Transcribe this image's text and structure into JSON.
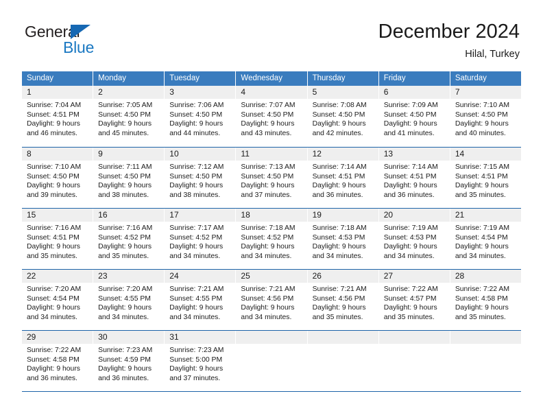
{
  "logo": {
    "word1": "General",
    "word2": "Blue",
    "triangle_color": "#1668b3",
    "word2_color": "#1a78c2"
  },
  "header": {
    "title": "December 2024",
    "subtitle": "Hilal, Turkey"
  },
  "theme": {
    "header_bg": "#3a7cbe",
    "row_divider": "#1c63a8",
    "daynum_band": "#efefef",
    "text": "#1a1a1a"
  },
  "calendar": {
    "day_names": [
      "Sunday",
      "Monday",
      "Tuesday",
      "Wednesday",
      "Thursday",
      "Friday",
      "Saturday"
    ],
    "weeks": [
      [
        {
          "day": "1",
          "lines": [
            "Sunrise: 7:04 AM",
            "Sunset: 4:51 PM",
            "Daylight: 9 hours",
            "and 46 minutes."
          ]
        },
        {
          "day": "2",
          "lines": [
            "Sunrise: 7:05 AM",
            "Sunset: 4:50 PM",
            "Daylight: 9 hours",
            "and 45 minutes."
          ]
        },
        {
          "day": "3",
          "lines": [
            "Sunrise: 7:06 AM",
            "Sunset: 4:50 PM",
            "Daylight: 9 hours",
            "and 44 minutes."
          ]
        },
        {
          "day": "4",
          "lines": [
            "Sunrise: 7:07 AM",
            "Sunset: 4:50 PM",
            "Daylight: 9 hours",
            "and 43 minutes."
          ]
        },
        {
          "day": "5",
          "lines": [
            "Sunrise: 7:08 AM",
            "Sunset: 4:50 PM",
            "Daylight: 9 hours",
            "and 42 minutes."
          ]
        },
        {
          "day": "6",
          "lines": [
            "Sunrise: 7:09 AM",
            "Sunset: 4:50 PM",
            "Daylight: 9 hours",
            "and 41 minutes."
          ]
        },
        {
          "day": "7",
          "lines": [
            "Sunrise: 7:10 AM",
            "Sunset: 4:50 PM",
            "Daylight: 9 hours",
            "and 40 minutes."
          ]
        }
      ],
      [
        {
          "day": "8",
          "lines": [
            "Sunrise: 7:10 AM",
            "Sunset: 4:50 PM",
            "Daylight: 9 hours",
            "and 39 minutes."
          ]
        },
        {
          "day": "9",
          "lines": [
            "Sunrise: 7:11 AM",
            "Sunset: 4:50 PM",
            "Daylight: 9 hours",
            "and 38 minutes."
          ]
        },
        {
          "day": "10",
          "lines": [
            "Sunrise: 7:12 AM",
            "Sunset: 4:50 PM",
            "Daylight: 9 hours",
            "and 38 minutes."
          ]
        },
        {
          "day": "11",
          "lines": [
            "Sunrise: 7:13 AM",
            "Sunset: 4:50 PM",
            "Daylight: 9 hours",
            "and 37 minutes."
          ]
        },
        {
          "day": "12",
          "lines": [
            "Sunrise: 7:14 AM",
            "Sunset: 4:51 PM",
            "Daylight: 9 hours",
            "and 36 minutes."
          ]
        },
        {
          "day": "13",
          "lines": [
            "Sunrise: 7:14 AM",
            "Sunset: 4:51 PM",
            "Daylight: 9 hours",
            "and 36 minutes."
          ]
        },
        {
          "day": "14",
          "lines": [
            "Sunrise: 7:15 AM",
            "Sunset: 4:51 PM",
            "Daylight: 9 hours",
            "and 35 minutes."
          ]
        }
      ],
      [
        {
          "day": "15",
          "lines": [
            "Sunrise: 7:16 AM",
            "Sunset: 4:51 PM",
            "Daylight: 9 hours",
            "and 35 minutes."
          ]
        },
        {
          "day": "16",
          "lines": [
            "Sunrise: 7:16 AM",
            "Sunset: 4:52 PM",
            "Daylight: 9 hours",
            "and 35 minutes."
          ]
        },
        {
          "day": "17",
          "lines": [
            "Sunrise: 7:17 AM",
            "Sunset: 4:52 PM",
            "Daylight: 9 hours",
            "and 34 minutes."
          ]
        },
        {
          "day": "18",
          "lines": [
            "Sunrise: 7:18 AM",
            "Sunset: 4:52 PM",
            "Daylight: 9 hours",
            "and 34 minutes."
          ]
        },
        {
          "day": "19",
          "lines": [
            "Sunrise: 7:18 AM",
            "Sunset: 4:53 PM",
            "Daylight: 9 hours",
            "and 34 minutes."
          ]
        },
        {
          "day": "20",
          "lines": [
            "Sunrise: 7:19 AM",
            "Sunset: 4:53 PM",
            "Daylight: 9 hours",
            "and 34 minutes."
          ]
        },
        {
          "day": "21",
          "lines": [
            "Sunrise: 7:19 AM",
            "Sunset: 4:54 PM",
            "Daylight: 9 hours",
            "and 34 minutes."
          ]
        }
      ],
      [
        {
          "day": "22",
          "lines": [
            "Sunrise: 7:20 AM",
            "Sunset: 4:54 PM",
            "Daylight: 9 hours",
            "and 34 minutes."
          ]
        },
        {
          "day": "23",
          "lines": [
            "Sunrise: 7:20 AM",
            "Sunset: 4:55 PM",
            "Daylight: 9 hours",
            "and 34 minutes."
          ]
        },
        {
          "day": "24",
          "lines": [
            "Sunrise: 7:21 AM",
            "Sunset: 4:55 PM",
            "Daylight: 9 hours",
            "and 34 minutes."
          ]
        },
        {
          "day": "25",
          "lines": [
            "Sunrise: 7:21 AM",
            "Sunset: 4:56 PM",
            "Daylight: 9 hours",
            "and 34 minutes."
          ]
        },
        {
          "day": "26",
          "lines": [
            "Sunrise: 7:21 AM",
            "Sunset: 4:56 PM",
            "Daylight: 9 hours",
            "and 35 minutes."
          ]
        },
        {
          "day": "27",
          "lines": [
            "Sunrise: 7:22 AM",
            "Sunset: 4:57 PM",
            "Daylight: 9 hours",
            "and 35 minutes."
          ]
        },
        {
          "day": "28",
          "lines": [
            "Sunrise: 7:22 AM",
            "Sunset: 4:58 PM",
            "Daylight: 9 hours",
            "and 35 minutes."
          ]
        }
      ],
      [
        {
          "day": "29",
          "lines": [
            "Sunrise: 7:22 AM",
            "Sunset: 4:58 PM",
            "Daylight: 9 hours",
            "and 36 minutes."
          ]
        },
        {
          "day": "30",
          "lines": [
            "Sunrise: 7:23 AM",
            "Sunset: 4:59 PM",
            "Daylight: 9 hours",
            "and 36 minutes."
          ]
        },
        {
          "day": "31",
          "lines": [
            "Sunrise: 7:23 AM",
            "Sunset: 5:00 PM",
            "Daylight: 9 hours",
            "and 37 minutes."
          ]
        },
        {
          "day": "",
          "lines": []
        },
        {
          "day": "",
          "lines": []
        },
        {
          "day": "",
          "lines": []
        },
        {
          "day": "",
          "lines": []
        }
      ]
    ]
  }
}
